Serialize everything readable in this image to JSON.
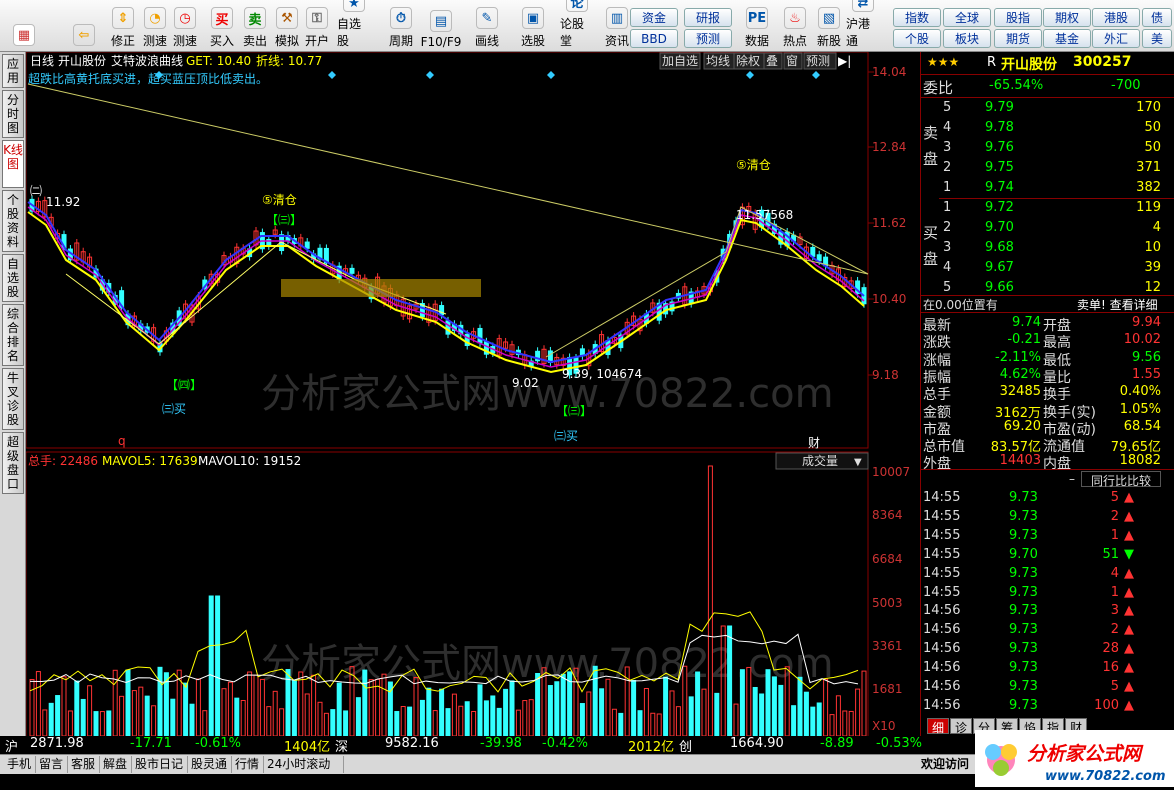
{
  "toolbar": {
    "buttons": [
      {
        "label": "",
        "icon": "flag-icon",
        "color": "#c33"
      },
      {
        "label": "",
        "icon": "back-arrow-icon",
        "color": "#f0a000"
      },
      {
        "label": "修正",
        "icon": "up-down-arrow-icon",
        "color": "#f0a000"
      },
      {
        "label": "测速",
        "icon": "speed-icon",
        "color": "#f0a000"
      },
      {
        "label": "测速",
        "icon": "clock-icon",
        "color": "#e00"
      },
      {
        "label": "买入",
        "icon": "buy-icon",
        "color": "#e00"
      },
      {
        "label": "卖出",
        "icon": "sell-icon",
        "color": "#080"
      },
      {
        "label": "模拟",
        "icon": "hammer-icon",
        "color": "#a50"
      },
      {
        "label": "开户",
        "icon": "lock-icon",
        "color": "#666"
      },
      {
        "label": "自选股",
        "icon": "star-list-icon",
        "color": "#0055aa"
      },
      {
        "label": "周期",
        "icon": "period-icon",
        "color": "#0055aa"
      },
      {
        "label": "F10/F9",
        "icon": "f10-icon",
        "color": "#0055aa"
      },
      {
        "label": "画线",
        "icon": "pen-icon",
        "color": "#0055aa"
      },
      {
        "label": "选股",
        "icon": "select-stock-icon",
        "color": "#0055aa"
      },
      {
        "label": "论股堂",
        "icon": "forum-icon",
        "color": "#0055aa"
      },
      {
        "label": "资讯",
        "icon": "news-icon",
        "color": "#0055aa"
      },
      {
        "label": "数据",
        "icon": "pe-icon",
        "color": "#0055aa"
      },
      {
        "label": "热点",
        "icon": "hot-icon",
        "color": "#e00"
      },
      {
        "label": "新股",
        "icon": "new-stock-icon",
        "color": "#0055aa"
      },
      {
        "label": "沪港通",
        "icon": "sse-hke-icon",
        "color": "#0055aa"
      }
    ],
    "small": [
      "资金",
      "研报",
      "BBD",
      "预测",
      "指数",
      "全球",
      "股指",
      "期权",
      "港股",
      "债",
      "个股",
      "板块",
      "期货",
      "基金",
      "外汇",
      "美"
    ]
  },
  "sidetabs": [
    "应用",
    "分时图",
    "K线图",
    "个股资料",
    "自选股",
    "综合排名",
    "牛叉诊股",
    "超级盘口"
  ],
  "chart": {
    "header": {
      "period": "日线",
      "name": "开山股份",
      "indicator": "艾特波浪曲线",
      "get": "GET: 10.40",
      "fold": "折线: 10.77"
    },
    "note": "超跌比高黄托底买进，超买蓝压顶比低卖出。",
    "buttons": [
      "加自选",
      "均线",
      "除权",
      "叠",
      "窗",
      "预测"
    ],
    "price_axis": [
      "14.04",
      "12.84",
      "11.62",
      "10.40",
      "9.18"
    ],
    "annotations": {
      "high1": "11.92",
      "clear1": "⑤清仓",
      "clear2": "⑤清仓",
      "low1": "9.02",
      "low2": "9.39, 104674",
      "high2": "11.57568",
      "buy1": "㈢买",
      "buy2": "㈢买",
      "wave": "㈡",
      "tag1": "【㈢】",
      "tag2": "【㈣】",
      "tag3": "【㈢】",
      "q": "q",
      "cai": "财",
      "watermark": "分析家公式网www.70822.com"
    },
    "vol_header": {
      "total": "总手: 22486",
      "mavol5": "MAVOL5: 17639",
      "mavol10": "MAVOL10: 19152",
      "select": "成交量"
    },
    "vol_axis": [
      "10007",
      "8364",
      "6684",
      "5003",
      "3361",
      "1681",
      "X10"
    ]
  },
  "chart_data": {
    "type": "bar",
    "title": "开山股份 300257 日线",
    "ylim": [
      9.18,
      14.04
    ],
    "series": [
      {
        "name": "MAVOL5",
        "values": [
          17639
        ]
      },
      {
        "name": "MAVOL10",
        "values": [
          19152
        ]
      }
    ]
  },
  "quote": {
    "stars": "★★★",
    "flag": "R",
    "name": "开山股份",
    "code": "300257",
    "weibi_label": "委比",
    "weibi": "-65.54%",
    "weicha": "-700",
    "sell_label": "卖盘",
    "buy_label": "买盘",
    "sell": [
      {
        "n": "5",
        "p": "9.79",
        "v": "170"
      },
      {
        "n": "4",
        "p": "9.78",
        "v": "50"
      },
      {
        "n": "3",
        "p": "9.76",
        "v": "50"
      },
      {
        "n": "2",
        "p": "9.75",
        "v": "371"
      },
      {
        "n": "1",
        "p": "9.74",
        "v": "382"
      }
    ],
    "buy": [
      {
        "n": "1",
        "p": "9.72",
        "v": "119"
      },
      {
        "n": "2",
        "p": "9.70",
        "v": "4"
      },
      {
        "n": "3",
        "p": "9.68",
        "v": "10"
      },
      {
        "n": "4",
        "p": "9.67",
        "v": "39"
      },
      {
        "n": "5",
        "p": "9.66",
        "v": "12"
      }
    ],
    "position": "在0.00位置有",
    "detail": "卖单! 查看详细",
    "stats": [
      {
        "l1": "最新",
        "v1": "9.74",
        "l2": "开盘",
        "v2": "9.94"
      },
      {
        "l1": "涨跌",
        "v1": "-0.21",
        "l2": "最高",
        "v2": "10.02"
      },
      {
        "l1": "涨幅",
        "v1": "-2.11%",
        "l2": "最低",
        "v2": "9.56"
      },
      {
        "l1": "振幅",
        "v1": "4.62%",
        "l2": "量比",
        "v2": "1.55"
      },
      {
        "l1": "总手",
        "v1": "32485",
        "l2": "换手",
        "v2": "0.40%"
      },
      {
        "l1": "金额",
        "v1": "3162万",
        "l2": "换手(实)",
        "v2": "1.05%"
      },
      {
        "l1": "市盈",
        "v1": "69.20",
        "l2": "市盈(动)",
        "v2": "68.54"
      },
      {
        "l1": "总市值",
        "v1": "83.57亿",
        "l2": "流通值",
        "v2": "79.65亿"
      },
      {
        "l1": "外盘",
        "v1": "14403",
        "l2": "内盘",
        "v2": "18082"
      }
    ],
    "compare": "同行比比较",
    "ticks": [
      {
        "t": "14:55",
        "p": "9.73",
        "v": "5",
        "d": "up"
      },
      {
        "t": "14:55",
        "p": "9.73",
        "v": "2",
        "d": "up"
      },
      {
        "t": "14:55",
        "p": "9.73",
        "v": "1",
        "d": "up"
      },
      {
        "t": "14:55",
        "p": "9.70",
        "v": "51",
        "d": "down"
      },
      {
        "t": "14:55",
        "p": "9.73",
        "v": "4",
        "d": "up"
      },
      {
        "t": "14:55",
        "p": "9.73",
        "v": "1",
        "d": "up"
      },
      {
        "t": "14:56",
        "p": "9.73",
        "v": "3",
        "d": "up"
      },
      {
        "t": "14:56",
        "p": "9.73",
        "v": "2",
        "d": "up"
      },
      {
        "t": "14:56",
        "p": "9.73",
        "v": "28",
        "d": "up"
      },
      {
        "t": "14:56",
        "p": "9.73",
        "v": "16",
        "d": "up"
      },
      {
        "t": "14:56",
        "p": "9.73",
        "v": "5",
        "d": "up"
      },
      {
        "t": "14:56",
        "p": "9.73",
        "v": "100",
        "d": "up"
      }
    ],
    "bottom_tabs": [
      "细",
      "诊",
      "分",
      "筹",
      "焰",
      "指",
      "财"
    ]
  },
  "status": {
    "sh": "沪",
    "sh_v": "2871.98",
    "sh_c": "-17.71",
    "sh_p": "-0.61%",
    "sh_a": "1404亿",
    "sz": "深",
    "sz_v": "9582.16",
    "sz_c": "-39.98",
    "sz_p": "-0.42%",
    "sz_a": "2012亿",
    "cy": "创",
    "cy_v": "1664.90",
    "cy_c": "-8.89",
    "cy_p": "-0.53%"
  },
  "bottom": [
    "手机",
    "留言",
    "客服",
    "解盘",
    "股市日记",
    "股灵通",
    "行情",
    "24小时滚动"
  ],
  "welcome": "欢迎访问",
  "logo": {
    "text": "分析家公式网",
    "url": "www.70822.com"
  }
}
